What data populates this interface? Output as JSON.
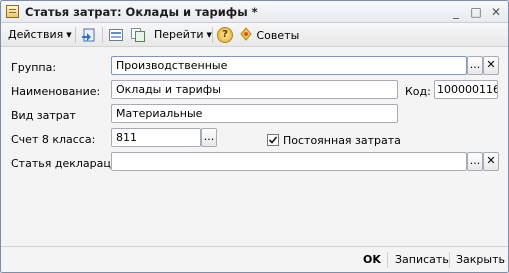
{
  "window": {
    "title": "Статья затрат: Оклады и тарифы *",
    "controls": {
      "minimize": "_",
      "maximize": "□",
      "close": "✕"
    }
  },
  "toolbar": {
    "actions_label": "Действия",
    "goto_label": "Перейти",
    "help_label": "?",
    "tips_label": "Советы",
    "icons": [
      "save-close-icon",
      "list-icon",
      "copy-icon",
      "help-icon",
      "tips-icon"
    ]
  },
  "form": {
    "group": {
      "label": "Группа:",
      "value": "Производственные"
    },
    "name": {
      "label": "Наименование:",
      "value": "Оклады и тарифы"
    },
    "code": {
      "label": "Код:",
      "value": "100000116"
    },
    "cost_type": {
      "label": "Вид затрат",
      "value": "Материальные"
    },
    "account": {
      "label": "Счет 8 класса:",
      "value": "811"
    },
    "permanent": {
      "label": "Постоянная затрата",
      "checked": true
    },
    "declaration": {
      "label": "Статья декларац...",
      "value": ""
    },
    "select_button": "...",
    "clear_button": "✕"
  },
  "footer": {
    "ok_label": "OK",
    "write_label": "Записать",
    "close_label": "Закрыть"
  },
  "colors": {
    "window_border": "#7d8ea8",
    "field_border": "#a5acb5",
    "background": "#f4f4f4"
  }
}
